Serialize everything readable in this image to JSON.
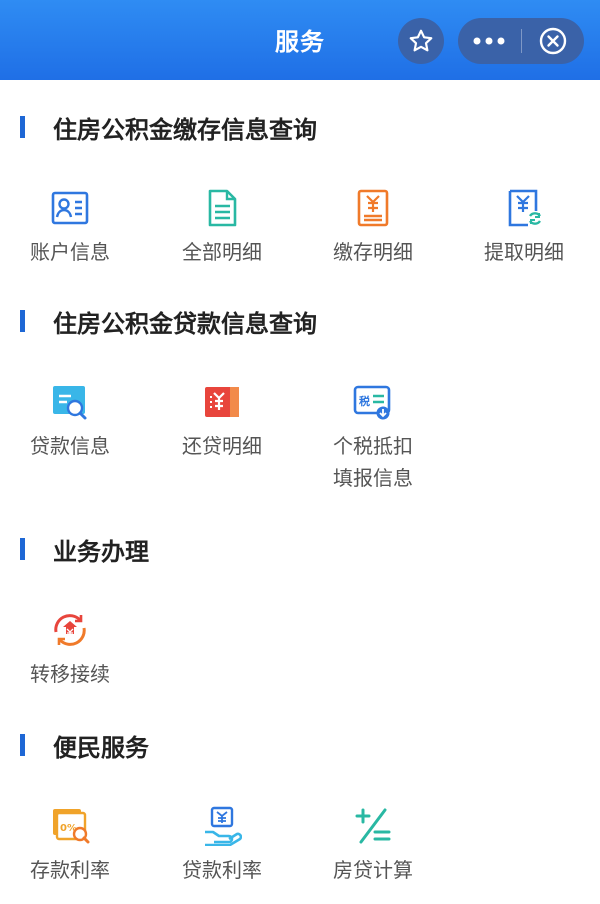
{
  "header": {
    "title": "服务"
  },
  "sections": [
    {
      "title": "住房公积金缴存信息查询",
      "items": [
        {
          "label": "账户信息",
          "icon": "account-card-icon"
        },
        {
          "label": "全部明细",
          "icon": "document-icon"
        },
        {
          "label": "缴存明细",
          "icon": "deposit-bill-icon"
        },
        {
          "label": "提取明细",
          "icon": "withdraw-bill-icon"
        }
      ]
    },
    {
      "title": "住房公积金贷款信息查询",
      "items": [
        {
          "label": "贷款信息",
          "icon": "loan-search-icon"
        },
        {
          "label": "还贷明细",
          "icon": "repayment-card-icon"
        },
        {
          "label": "个税抵扣",
          "label2": "填报信息",
          "icon": "tax-report-icon"
        }
      ]
    },
    {
      "title": "业务办理",
      "items": [
        {
          "label": "转移接续",
          "icon": "transfer-circle-icon"
        }
      ]
    },
    {
      "title": "便民服务",
      "items": [
        {
          "label": "存款利率",
          "icon": "deposit-rate-icon"
        },
        {
          "label": "贷款利率",
          "icon": "loan-rate-icon"
        },
        {
          "label": "房贷计算",
          "icon": "calculator-icon"
        }
      ]
    }
  ],
  "colors": {
    "header": "#2479ee",
    "section_bar": "#1e67d5",
    "blue_icon": "#2f77df",
    "teal_icon": "#29b8a3",
    "orange_icon": "#f07a2a",
    "red_icon": "#e8453c",
    "yellow_icon": "#f0a32a"
  }
}
